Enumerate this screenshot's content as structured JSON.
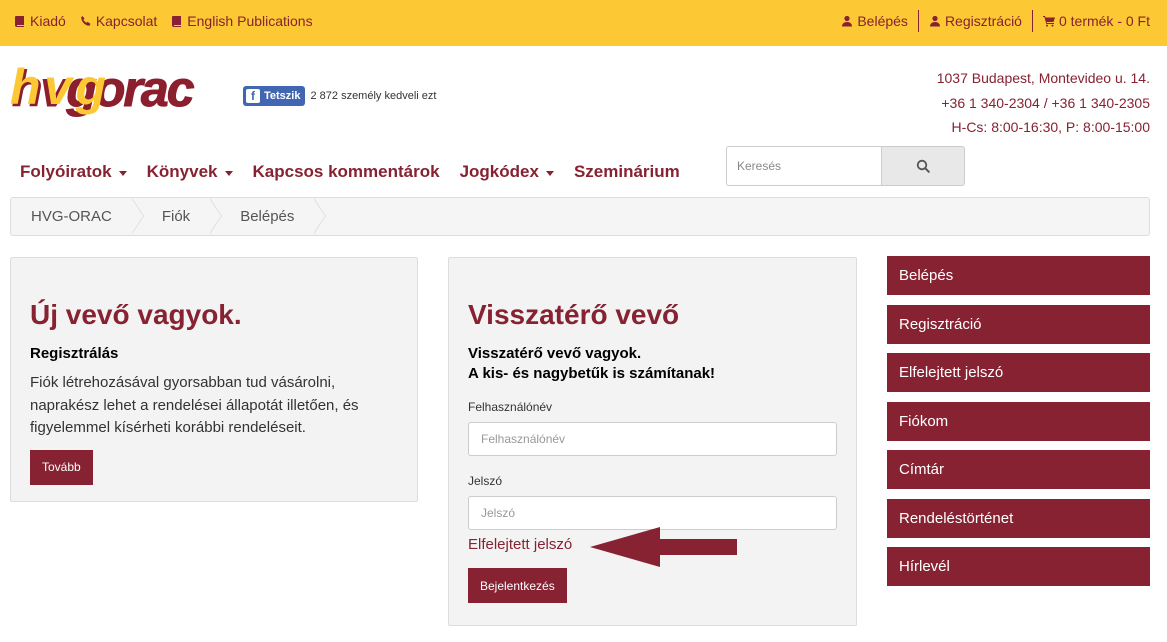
{
  "topbar": {
    "left": [
      {
        "label": "Kiadó",
        "icon": "book-icon"
      },
      {
        "label": "Kapcsolat",
        "icon": "phone-icon"
      },
      {
        "label": "English Publications",
        "icon": "book-icon"
      }
    ],
    "login": "Belépés",
    "register": "Regisztráció",
    "cart": "0 termék - 0 Ft"
  },
  "header": {
    "logo_text": "hvgorac",
    "fb_like": "Tetszik",
    "fb_count": "2 872 személy kedveli ezt",
    "address": "1037 Budapest, Montevideo u. 14.",
    "phone": "+36 1 340-2304 / +36 1 340-2305",
    "hours": "H-Cs: 8:00-16:30, P: 8:00-15:00"
  },
  "nav": {
    "items": [
      {
        "label": "Folyóiratok",
        "dropdown": true
      },
      {
        "label": "Könyvek",
        "dropdown": true
      },
      {
        "label": "Kapcsos kommentárok",
        "dropdown": false
      },
      {
        "label": "Jogkódex",
        "dropdown": true
      },
      {
        "label": "Szeminárium",
        "dropdown": false
      }
    ],
    "search_placeholder": "Keresés"
  },
  "breadcrumb": [
    "HVG-ORAC",
    "Fiók",
    "Belépés"
  ],
  "new_customer": {
    "title": "Új vevő vagyok.",
    "subtitle": "Regisztrálás",
    "text": "Fiók létrehozásával gyorsabban tud vásárolni, naprakész lehet a rendelései állapotát illetően, és figyelemmel kísérheti korábbi rendeléseit.",
    "button": "Tovább"
  },
  "returning_customer": {
    "title": "Visszatérő vevő",
    "subtitle1": "Visszatérő vevő vagyok.",
    "subtitle2": "A kis- és nagybetűk is számítanak!",
    "username_label": "Felhasználónév",
    "username_placeholder": "Felhasználónév",
    "password_label": "Jelszó",
    "password_placeholder": "Jelszó",
    "forgot": "Elfelejtett jelszó",
    "button": "Bejelentkezés"
  },
  "sidebar": {
    "items": [
      "Belépés",
      "Regisztráció",
      "Elfelejtett jelszó",
      "Fiókom",
      "Címtár",
      "Rendeléstörténet",
      "Hírlevél"
    ]
  },
  "colors": {
    "accent": "#862232",
    "topbar": "#fcc934"
  }
}
